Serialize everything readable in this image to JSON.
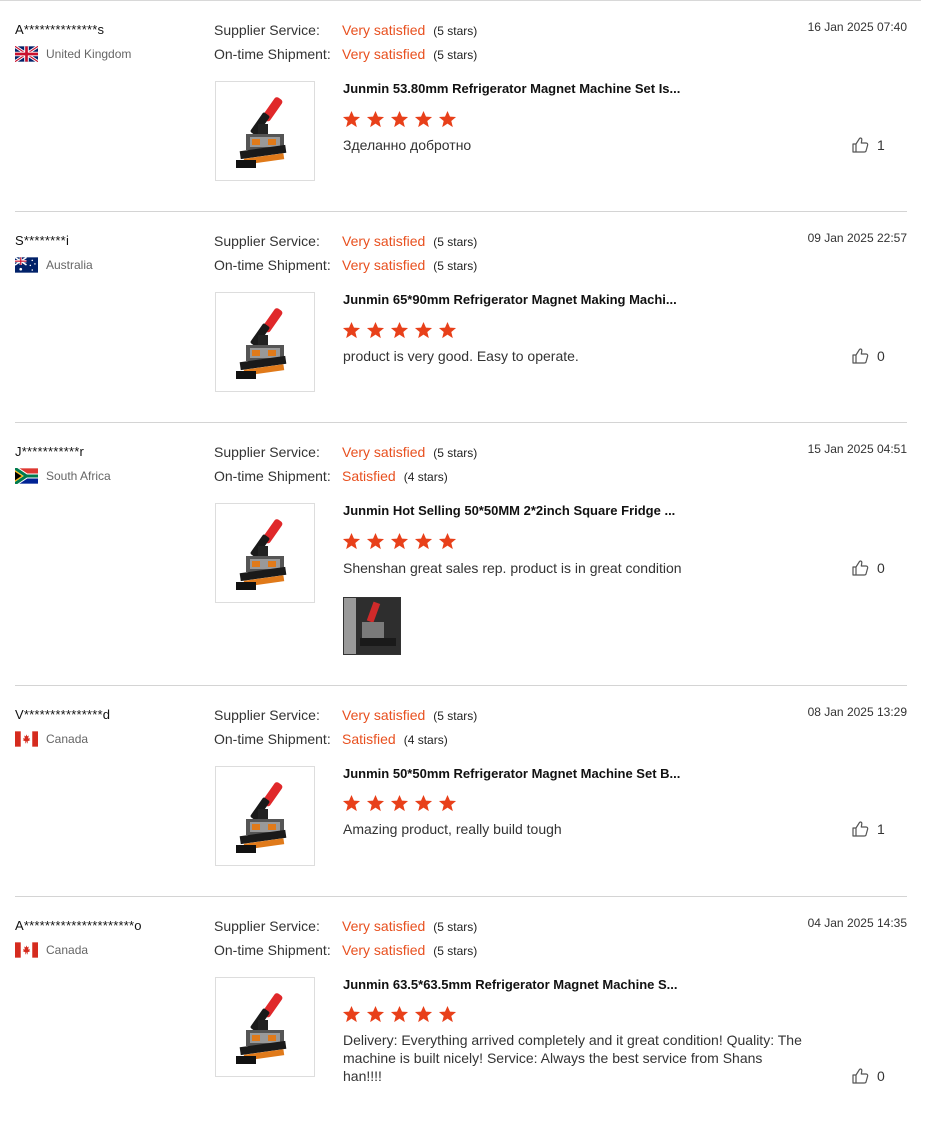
{
  "labels": {
    "supplier_service": "Supplier Service:",
    "on_time_shipment": "On-time Shipment:"
  },
  "colors": {
    "accent": "#e8501f",
    "star": "#e8401a"
  },
  "reviews": [
    {
      "reviewer": "A**************s",
      "country": "United Kingdom",
      "flag_icon": "uk-flag-icon",
      "supplier_service": "Very satisfied",
      "supplier_stars": "(5 stars)",
      "on_time_shipment": "Very satisfied",
      "shipment_stars": "(5 stars)",
      "date": "16 Jan 2025 07:40",
      "product_title": "Junmin 53.80mm Refrigerator Magnet Machine Set Is...",
      "rating": 5,
      "comment": "Зделанно добротно",
      "helpful_count": "1"
    },
    {
      "reviewer": "S********i",
      "country": "Australia",
      "flag_icon": "australia-flag-icon",
      "supplier_service": "Very satisfied",
      "supplier_stars": "(5 stars)",
      "on_time_shipment": "Very satisfied",
      "shipment_stars": "(5 stars)",
      "date": "09 Jan 2025 22:57",
      "product_title": "Junmin 65*90mm Refrigerator Magnet Making Machi...",
      "rating": 5,
      "comment": "product is very good. Easy to operate.",
      "helpful_count": "0"
    },
    {
      "reviewer": "J***********r",
      "country": "South Africa",
      "flag_icon": "south-africa-flag-icon",
      "supplier_service": "Very satisfied",
      "supplier_stars": "(5 stars)",
      "on_time_shipment": "Satisfied",
      "shipment_stars": "(4 stars)",
      "date": "15 Jan 2025 04:51",
      "product_title": "Junmin Hot Selling 50*50MM 2*2inch Square Fridge ...",
      "rating": 5,
      "comment": "Shenshan great sales rep. product is in great condition",
      "helpful_count": "0"
    },
    {
      "reviewer": "V***************d",
      "country": "Canada",
      "flag_icon": "canada-flag-icon",
      "supplier_service": "Very satisfied",
      "supplier_stars": "(5 stars)",
      "on_time_shipment": "Satisfied",
      "shipment_stars": "(4 stars)",
      "date": "08 Jan 2025 13:29",
      "product_title": "Junmin 50*50mm Refrigerator Magnet Machine Set B...",
      "rating": 5,
      "comment": "Amazing product, really build tough",
      "helpful_count": "1"
    },
    {
      "reviewer": "A*********************o",
      "country": "Canada",
      "flag_icon": "canada-flag-icon",
      "supplier_service": "Very satisfied",
      "supplier_stars": "(5 stars)",
      "on_time_shipment": "Very satisfied",
      "shipment_stars": "(5 stars)",
      "date": "04 Jan 2025 14:35",
      "product_title": "Junmin 63.5*63.5mm Refrigerator Magnet Machine S...",
      "rating": 5,
      "comment": "Delivery:  Everything arrived completely and it great condition!  Quality:  The machine is built nicely! Service:   Always the best service from Shans han!!!!",
      "helpful_count": "0"
    }
  ]
}
